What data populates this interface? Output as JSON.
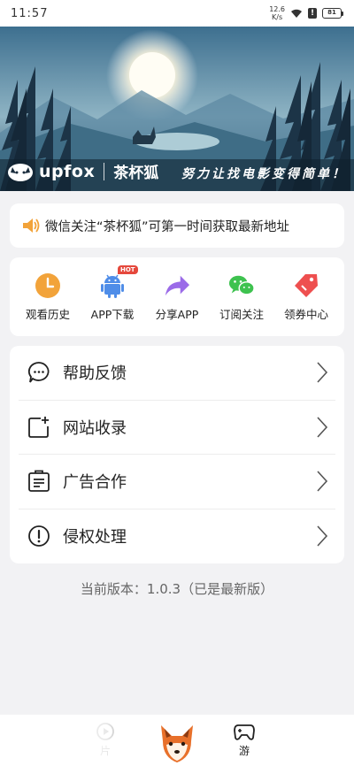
{
  "status_bar": {
    "time": "11:57",
    "speed_value": "12.6",
    "speed_unit": "K/s",
    "battery": "81"
  },
  "banner": {
    "brand_en": "upfox",
    "brand_cn": "茶杯狐",
    "slogan": "努力让找电影变得简单！"
  },
  "notice": {
    "text": "微信关注“茶杯狐”可第一时间获取最新地址"
  },
  "quick_actions": [
    {
      "label": "观看历史",
      "icon": "clock-icon"
    },
    {
      "label": "APP下载",
      "icon": "android-icon",
      "badge": "HOT"
    },
    {
      "label": "分享APP",
      "icon": "share-arrow-icon"
    },
    {
      "label": "订阅关注",
      "icon": "wechat-icon"
    },
    {
      "label": "领券中心",
      "icon": "coupon-tag-icon"
    }
  ],
  "menu": [
    {
      "label": "帮助反馈",
      "icon": "chat-bubble-icon"
    },
    {
      "label": "网站收录",
      "icon": "add-square-icon"
    },
    {
      "label": "广告合作",
      "icon": "document-icon"
    },
    {
      "label": "侵权处理",
      "icon": "alert-circle-icon"
    }
  ],
  "version_text": "当前版本：1.0.3（已是最新版）",
  "tabbar": {
    "left_label": "片",
    "right_label": "游"
  },
  "colors": {
    "page_bg": "#f2f2f4",
    "orange": "#f2a33a",
    "android_blue": "#4f8de8",
    "share_purple": "#9b6be8",
    "wechat_green": "#3ec24f",
    "coupon_red": "#ee4f4f",
    "hot_red": "#e5483c"
  }
}
